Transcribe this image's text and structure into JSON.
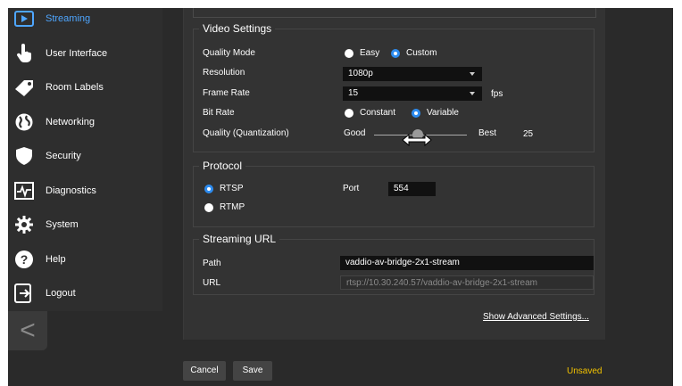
{
  "sidebar": {
    "items": [
      {
        "label": "Streaming",
        "icon": "play-icon"
      },
      {
        "label": "User Interface",
        "icon": "hand-pointer-icon"
      },
      {
        "label": "Room Labels",
        "icon": "tag-icon"
      },
      {
        "label": "Networking",
        "icon": "globe-icon"
      },
      {
        "label": "Security",
        "icon": "shield-icon"
      },
      {
        "label": "Diagnostics",
        "icon": "pulse-icon"
      },
      {
        "label": "System",
        "icon": "gear-icon"
      },
      {
        "label": "Help",
        "icon": "question-icon"
      },
      {
        "label": "Logout",
        "icon": "logout-icon"
      }
    ],
    "collapse_glyph": "<"
  },
  "video": {
    "legend": "Video Settings",
    "quality_mode_label": "Quality Mode",
    "quality_mode_options": [
      "Easy",
      "Custom"
    ],
    "quality_mode_selected": "Custom",
    "resolution_label": "Resolution",
    "resolution_value": "1080p",
    "frame_rate_label": "Frame Rate",
    "frame_rate_value": "15",
    "frame_rate_unit": "fps",
    "bit_rate_label": "Bit Rate",
    "bit_rate_options": [
      "Constant",
      "Variable"
    ],
    "bit_rate_selected": "Variable",
    "quantization_label": "Quality (Quantization)",
    "slider_min_label": "Good",
    "slider_max_label": "Best",
    "slider_value": "25"
  },
  "protocol": {
    "legend": "Protocol",
    "options": [
      "RTSP",
      "RTMP"
    ],
    "selected": "RTSP",
    "port_label": "Port",
    "port_value": "554"
  },
  "streaming_url": {
    "legend": "Streaming URL",
    "path_label": "Path",
    "path_value": "vaddio-av-bridge-2x1-stream",
    "url_label": "URL",
    "url_value": "rtsp://10.30.240.57/vaddio-av-bridge-2x1-stream"
  },
  "advanced_link": "Show Advanced Settings...",
  "footer": {
    "cancel": "Cancel",
    "save": "Save",
    "status": "Unsaved"
  },
  "colors": {
    "accent": "#2d8cf0",
    "unsaved": "#f2c200"
  }
}
